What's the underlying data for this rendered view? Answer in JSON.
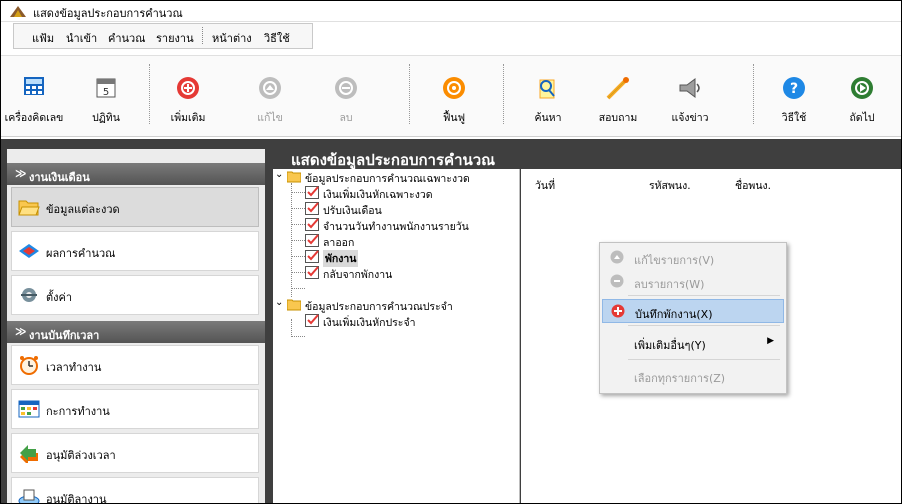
{
  "window": {
    "title": "แสดงข้อมูลประกอบการคำนวณ"
  },
  "menubar": {
    "items": [
      "แฟ้ม",
      "นำเข้า",
      "คำนวณ",
      "รายงาน",
      "หน้าต่าง",
      "วิธีใช้"
    ]
  },
  "toolbar": {
    "buttons": [
      {
        "label": "เครื่องคิดเลข",
        "icon": "calculator-icon",
        "enabled": true
      },
      {
        "label": "ปฏิทิน",
        "icon": "calendar-icon",
        "enabled": true
      },
      {
        "label": "เพิ่มเติม",
        "icon": "add-icon",
        "enabled": true
      },
      {
        "label": "แก้ไข",
        "icon": "edit-icon",
        "enabled": false
      },
      {
        "label": "ลบ",
        "icon": "delete-icon",
        "enabled": false
      },
      {
        "label": "ฟื้นฟู",
        "icon": "refresh-icon",
        "enabled": true
      },
      {
        "label": "ค้นหา",
        "icon": "search-icon",
        "enabled": true
      },
      {
        "label": "สอบถาม",
        "icon": "inquiry-icon",
        "enabled": true
      },
      {
        "label": "แจ้งข่าว",
        "icon": "announce-icon",
        "enabled": true
      },
      {
        "label": "วิธีใช้",
        "icon": "help-icon",
        "enabled": true
      },
      {
        "label": "ถัดไป",
        "icon": "next-icon",
        "enabled": true
      }
    ]
  },
  "sidebar": {
    "groups": [
      {
        "title": "งานเงินเดือน",
        "items": [
          {
            "label": "ข้อมูลแต่ละงวด",
            "icon": "folder-open-icon",
            "active": true
          },
          {
            "label": "ผลการคำนวณ",
            "icon": "calculation-result-icon",
            "active": false
          },
          {
            "label": "ตั้งค่า",
            "icon": "settings-icon",
            "active": false
          }
        ]
      },
      {
        "title": "งานบันทึกเวลา",
        "items": [
          {
            "label": "เวลาทำงาน",
            "icon": "alarm-clock-icon",
            "active": false
          },
          {
            "label": "กะการทำงาน",
            "icon": "shift-schedule-icon",
            "active": false
          },
          {
            "label": "อนุมัติล่วงเวลา",
            "icon": "overtime-approval-icon",
            "active": false
          },
          {
            "label": "อนุมัติลางาน",
            "icon": "leave-approval-icon",
            "active": false
          }
        ]
      }
    ]
  },
  "main": {
    "title": "แสดงข้อมูลประกอบการคำนวณ",
    "tree": {
      "nodes": [
        {
          "label": "ข้อมูลประกอบการคำนวณเฉพาะงวด",
          "children": [
            "เงินเพิ่มเงินหักเฉพาะงวด",
            "ปรับเงินเดือน",
            "จำนวนวันทำงานพนักงานรายวัน",
            "ลาออก",
            "พักงาน",
            "กลับจากพักงาน"
          ]
        },
        {
          "label": "ข้อมูลประกอบการคำนวณประจำ",
          "children": [
            "เงินเพิ่มเงินหักประจำ"
          ]
        }
      ],
      "selected": "พักงาน"
    },
    "list": {
      "columns": [
        "วันที่",
        "รหัสพนง.",
        "ชื่อพนง."
      ]
    }
  },
  "context_menu": {
    "items": [
      {
        "label": "แก้ไขรายการ(V)",
        "enabled": false,
        "icon": "edit-icon"
      },
      {
        "label": "ลบรายการ(W)",
        "enabled": false,
        "icon": "delete-icon"
      },
      {
        "label": "บันทึกพักงาน(X)",
        "enabled": true,
        "icon": "add-icon",
        "highlighted": true
      },
      {
        "label": "เพิ่มเติมอื่นๆ(Y)",
        "enabled": true,
        "submenu": true
      },
      {
        "label": "เลือกทุกรายการ(Z)",
        "enabled": false
      }
    ]
  },
  "colors": {
    "accent_red": "#e53935",
    "green": "#2e7d32",
    "highlight": "#bcd5f0",
    "header_dark": "#3f3f3f"
  }
}
